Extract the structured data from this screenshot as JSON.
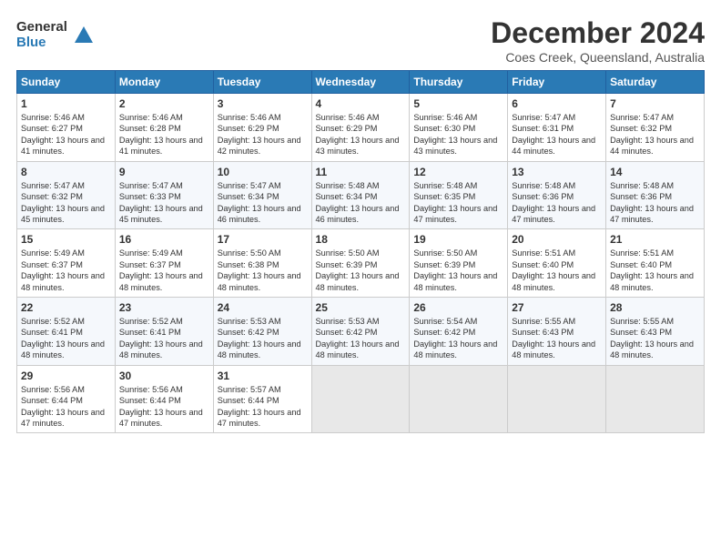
{
  "logo": {
    "general": "General",
    "blue": "Blue"
  },
  "title": "December 2024",
  "subtitle": "Coes Creek, Queensland, Australia",
  "days_of_week": [
    "Sunday",
    "Monday",
    "Tuesday",
    "Wednesday",
    "Thursday",
    "Friday",
    "Saturday"
  ],
  "weeks": [
    [
      {
        "day": "1",
        "sunrise": "5:46 AM",
        "sunset": "6:27 PM",
        "daylight": "13 hours and 41 minutes."
      },
      {
        "day": "2",
        "sunrise": "5:46 AM",
        "sunset": "6:28 PM",
        "daylight": "13 hours and 41 minutes."
      },
      {
        "day": "3",
        "sunrise": "5:46 AM",
        "sunset": "6:29 PM",
        "daylight": "13 hours and 42 minutes."
      },
      {
        "day": "4",
        "sunrise": "5:46 AM",
        "sunset": "6:29 PM",
        "daylight": "13 hours and 43 minutes."
      },
      {
        "day": "5",
        "sunrise": "5:46 AM",
        "sunset": "6:30 PM",
        "daylight": "13 hours and 43 minutes."
      },
      {
        "day": "6",
        "sunrise": "5:47 AM",
        "sunset": "6:31 PM",
        "daylight": "13 hours and 44 minutes."
      },
      {
        "day": "7",
        "sunrise": "5:47 AM",
        "sunset": "6:32 PM",
        "daylight": "13 hours and 44 minutes."
      }
    ],
    [
      {
        "day": "8",
        "sunrise": "5:47 AM",
        "sunset": "6:32 PM",
        "daylight": "13 hours and 45 minutes."
      },
      {
        "day": "9",
        "sunrise": "5:47 AM",
        "sunset": "6:33 PM",
        "daylight": "13 hours and 45 minutes."
      },
      {
        "day": "10",
        "sunrise": "5:47 AM",
        "sunset": "6:34 PM",
        "daylight": "13 hours and 46 minutes."
      },
      {
        "day": "11",
        "sunrise": "5:48 AM",
        "sunset": "6:34 PM",
        "daylight": "13 hours and 46 minutes."
      },
      {
        "day": "12",
        "sunrise": "5:48 AM",
        "sunset": "6:35 PM",
        "daylight": "13 hours and 47 minutes."
      },
      {
        "day": "13",
        "sunrise": "5:48 AM",
        "sunset": "6:36 PM",
        "daylight": "13 hours and 47 minutes."
      },
      {
        "day": "14",
        "sunrise": "5:48 AM",
        "sunset": "6:36 PM",
        "daylight": "13 hours and 47 minutes."
      }
    ],
    [
      {
        "day": "15",
        "sunrise": "5:49 AM",
        "sunset": "6:37 PM",
        "daylight": "13 hours and 48 minutes."
      },
      {
        "day": "16",
        "sunrise": "5:49 AM",
        "sunset": "6:37 PM",
        "daylight": "13 hours and 48 minutes."
      },
      {
        "day": "17",
        "sunrise": "5:50 AM",
        "sunset": "6:38 PM",
        "daylight": "13 hours and 48 minutes."
      },
      {
        "day": "18",
        "sunrise": "5:50 AM",
        "sunset": "6:39 PM",
        "daylight": "13 hours and 48 minutes."
      },
      {
        "day": "19",
        "sunrise": "5:50 AM",
        "sunset": "6:39 PM",
        "daylight": "13 hours and 48 minutes."
      },
      {
        "day": "20",
        "sunrise": "5:51 AM",
        "sunset": "6:40 PM",
        "daylight": "13 hours and 48 minutes."
      },
      {
        "day": "21",
        "sunrise": "5:51 AM",
        "sunset": "6:40 PM",
        "daylight": "13 hours and 48 minutes."
      }
    ],
    [
      {
        "day": "22",
        "sunrise": "5:52 AM",
        "sunset": "6:41 PM",
        "daylight": "13 hours and 48 minutes."
      },
      {
        "day": "23",
        "sunrise": "5:52 AM",
        "sunset": "6:41 PM",
        "daylight": "13 hours and 48 minutes."
      },
      {
        "day": "24",
        "sunrise": "5:53 AM",
        "sunset": "6:42 PM",
        "daylight": "13 hours and 48 minutes."
      },
      {
        "day": "25",
        "sunrise": "5:53 AM",
        "sunset": "6:42 PM",
        "daylight": "13 hours and 48 minutes."
      },
      {
        "day": "26",
        "sunrise": "5:54 AM",
        "sunset": "6:42 PM",
        "daylight": "13 hours and 48 minutes."
      },
      {
        "day": "27",
        "sunrise": "5:55 AM",
        "sunset": "6:43 PM",
        "daylight": "13 hours and 48 minutes."
      },
      {
        "day": "28",
        "sunrise": "5:55 AM",
        "sunset": "6:43 PM",
        "daylight": "13 hours and 48 minutes."
      }
    ],
    [
      {
        "day": "29",
        "sunrise": "5:56 AM",
        "sunset": "6:44 PM",
        "daylight": "13 hours and 47 minutes."
      },
      {
        "day": "30",
        "sunrise": "5:56 AM",
        "sunset": "6:44 PM",
        "daylight": "13 hours and 47 minutes."
      },
      {
        "day": "31",
        "sunrise": "5:57 AM",
        "sunset": "6:44 PM",
        "daylight": "13 hours and 47 minutes."
      },
      null,
      null,
      null,
      null
    ]
  ]
}
